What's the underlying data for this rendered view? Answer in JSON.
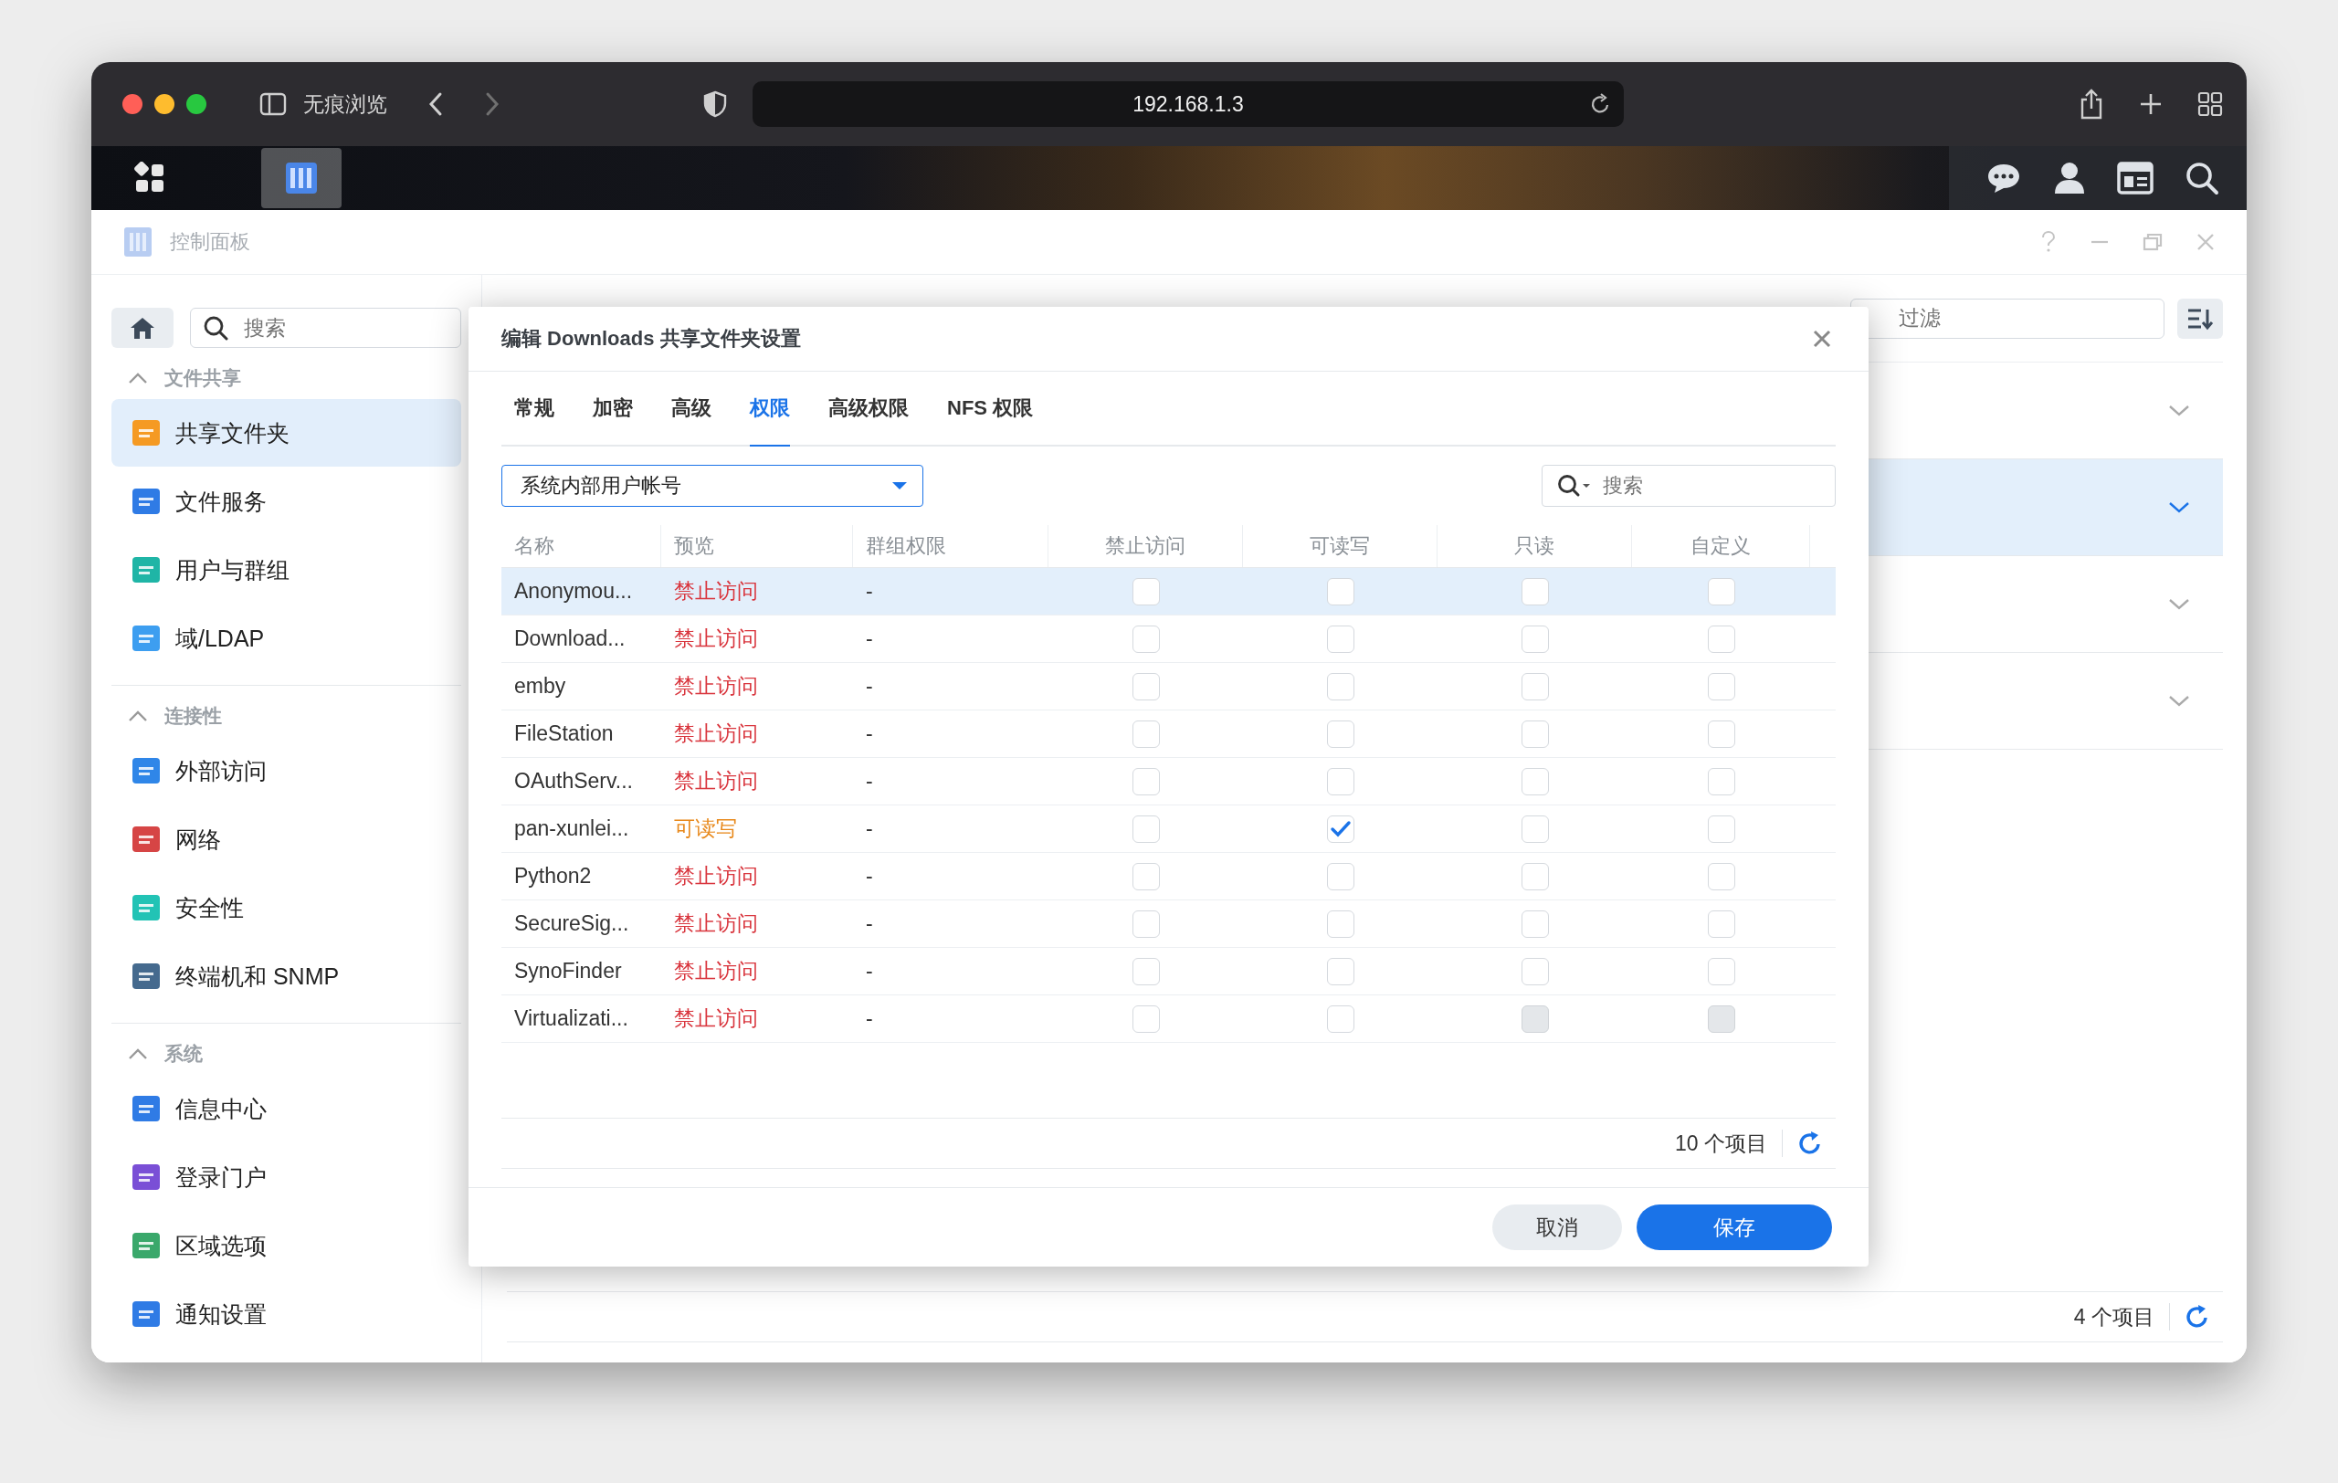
{
  "browser": {
    "private_label": "无痕浏览",
    "url": "192.168.1.3"
  },
  "app_window": {
    "title": "控制面板"
  },
  "sidebar": {
    "search_placeholder": "搜索",
    "sections": [
      {
        "title": "文件共享",
        "expanded": true,
        "items": [
          {
            "label": "共享文件夹",
            "selected": true
          },
          {
            "label": "文件服务",
            "selected": false
          },
          {
            "label": "用户与群组",
            "selected": false
          },
          {
            "label": "域/LDAP",
            "selected": false
          }
        ]
      },
      {
        "title": "连接性",
        "expanded": true,
        "items": [
          {
            "label": "外部访问",
            "selected": false
          },
          {
            "label": "网络",
            "selected": false
          },
          {
            "label": "安全性",
            "selected": false
          },
          {
            "label": "终端机和 SNMP",
            "selected": false
          }
        ]
      },
      {
        "title": "系统",
        "expanded": true,
        "items": [
          {
            "label": "信息中心",
            "selected": false
          },
          {
            "label": "登录门户",
            "selected": false
          },
          {
            "label": "区域选项",
            "selected": false
          },
          {
            "label": "通知设置",
            "selected": false
          }
        ]
      }
    ]
  },
  "main": {
    "filter_placeholder": "过滤",
    "rows": [
      {
        "selected": false
      },
      {
        "selected": true
      },
      {
        "selected": false
      },
      {
        "selected": false
      }
    ],
    "footer": "4 个项目"
  },
  "dialog": {
    "title": "编辑 Downloads 共享文件夹设置",
    "tabs": [
      {
        "label": "常规",
        "selected": false
      },
      {
        "label": "加密",
        "selected": false
      },
      {
        "label": "高级",
        "selected": false
      },
      {
        "label": "权限",
        "selected": true
      },
      {
        "label": "高级权限",
        "selected": false
      },
      {
        "label": "NFS 权限",
        "selected": false
      }
    ],
    "user_type": "系统内部用户帐号",
    "search_placeholder": "搜索",
    "columns": [
      "名称",
      "预览",
      "群组权限",
      "禁止访问",
      "可读写",
      "只读",
      "自定义"
    ],
    "rows": [
      {
        "name": "Anonymou...",
        "preview": "禁止访问",
        "color": "#d9363e",
        "group": "-",
        "selected": true,
        "checks": [
          {
            "checked": false,
            "disabled": false
          },
          {
            "checked": false,
            "disabled": false
          },
          {
            "checked": false,
            "disabled": false
          },
          {
            "checked": false,
            "disabled": false
          }
        ]
      },
      {
        "name": "Download...",
        "preview": "禁止访问",
        "color": "#d9363e",
        "group": "-",
        "selected": false,
        "checks": [
          {
            "checked": false,
            "disabled": false
          },
          {
            "checked": false,
            "disabled": false
          },
          {
            "checked": false,
            "disabled": false
          },
          {
            "checked": false,
            "disabled": false
          }
        ]
      },
      {
        "name": "emby",
        "preview": "禁止访问",
        "color": "#d9363e",
        "group": "-",
        "selected": false,
        "checks": [
          {
            "checked": false,
            "disabled": false
          },
          {
            "checked": false,
            "disabled": false
          },
          {
            "checked": false,
            "disabled": false
          },
          {
            "checked": false,
            "disabled": false
          }
        ]
      },
      {
        "name": "FileStation",
        "preview": "禁止访问",
        "color": "#d9363e",
        "group": "-",
        "selected": false,
        "checks": [
          {
            "checked": false,
            "disabled": false
          },
          {
            "checked": false,
            "disabled": false
          },
          {
            "checked": false,
            "disabled": false
          },
          {
            "checked": false,
            "disabled": false
          }
        ]
      },
      {
        "name": "OAuthServ...",
        "preview": "禁止访问",
        "color": "#d9363e",
        "group": "-",
        "selected": false,
        "checks": [
          {
            "checked": false,
            "disabled": false
          },
          {
            "checked": false,
            "disabled": false
          },
          {
            "checked": false,
            "disabled": false
          },
          {
            "checked": false,
            "disabled": false
          }
        ]
      },
      {
        "name": "pan-xunlei...",
        "preview": "可读写",
        "color": "#e8891c",
        "group": "-",
        "selected": false,
        "checks": [
          {
            "checked": false,
            "disabled": false
          },
          {
            "checked": true,
            "disabled": false
          },
          {
            "checked": false,
            "disabled": false
          },
          {
            "checked": false,
            "disabled": false
          }
        ]
      },
      {
        "name": "Python2",
        "preview": "禁止访问",
        "color": "#d9363e",
        "group": "-",
        "selected": false,
        "checks": [
          {
            "checked": false,
            "disabled": false
          },
          {
            "checked": false,
            "disabled": false
          },
          {
            "checked": false,
            "disabled": false
          },
          {
            "checked": false,
            "disabled": false
          }
        ]
      },
      {
        "name": "SecureSig...",
        "preview": "禁止访问",
        "color": "#d9363e",
        "group": "-",
        "selected": false,
        "checks": [
          {
            "checked": false,
            "disabled": false
          },
          {
            "checked": false,
            "disabled": false
          },
          {
            "checked": false,
            "disabled": false
          },
          {
            "checked": false,
            "disabled": false
          }
        ]
      },
      {
        "name": "SynoFinder",
        "preview": "禁止访问",
        "color": "#d9363e",
        "group": "-",
        "selected": false,
        "checks": [
          {
            "checked": false,
            "disabled": false
          },
          {
            "checked": false,
            "disabled": false
          },
          {
            "checked": false,
            "disabled": false
          },
          {
            "checked": false,
            "disabled": false
          }
        ]
      },
      {
        "name": "Virtualizati...",
        "preview": "禁止访问",
        "color": "#d9363e",
        "group": "-",
        "selected": false,
        "checks": [
          {
            "checked": false,
            "disabled": false
          },
          {
            "checked": false,
            "disabled": false
          },
          {
            "checked": false,
            "disabled": true
          },
          {
            "checked": false,
            "disabled": true
          }
        ]
      }
    ],
    "count": "10 个项目",
    "cancel": "取消",
    "save": "保存"
  }
}
